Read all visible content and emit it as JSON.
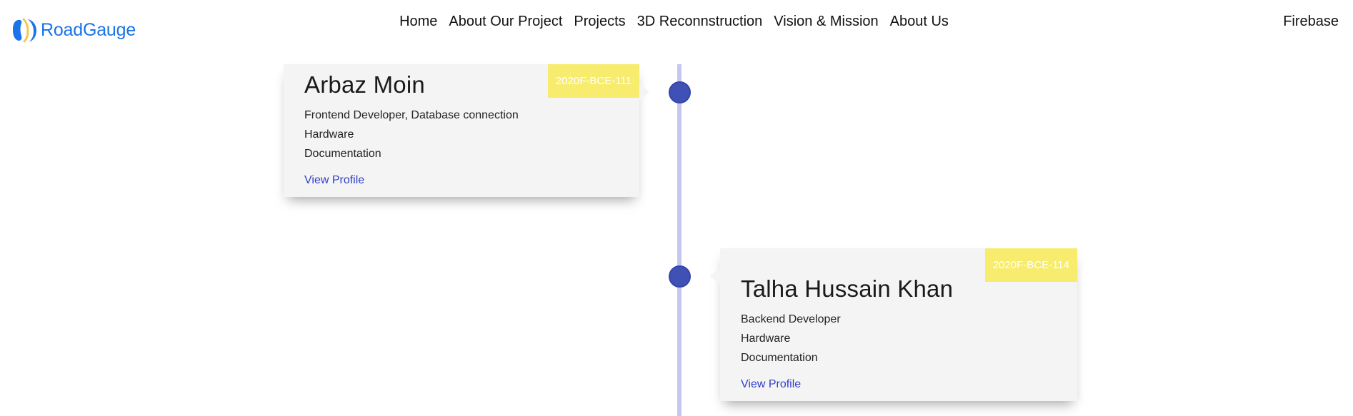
{
  "header": {
    "brand": "RoadGauge",
    "nav_items": [
      "Home",
      "About Our Project",
      "Projects",
      "3D Reconnstruction",
      "Vision & Mission",
      "About Us"
    ],
    "right_link": "Firebase"
  },
  "timeline": {
    "members": [
      {
        "name": "Arbaz Moin",
        "id": "2020F-BCE-111",
        "roles": [
          "Frontend Developer, Database connection",
          "Hardware",
          "Documentation"
        ],
        "link_label": "View Profile"
      },
      {
        "name": "Talha Hussain Khan",
        "id": "2020F-BCE-114",
        "roles": [
          "Backend Developer",
          "Hardware",
          "Documentation"
        ],
        "link_label": "View Profile"
      }
    ]
  },
  "colors": {
    "brand": "#1a73e8",
    "dot": "#3f51b5",
    "line": "#c5c8ee",
    "badge": "#f7ec6e",
    "link": "#2f3fc9",
    "card": "#f4f4f4"
  },
  "icons": {
    "logo": "road-gauge-logo-icon"
  }
}
